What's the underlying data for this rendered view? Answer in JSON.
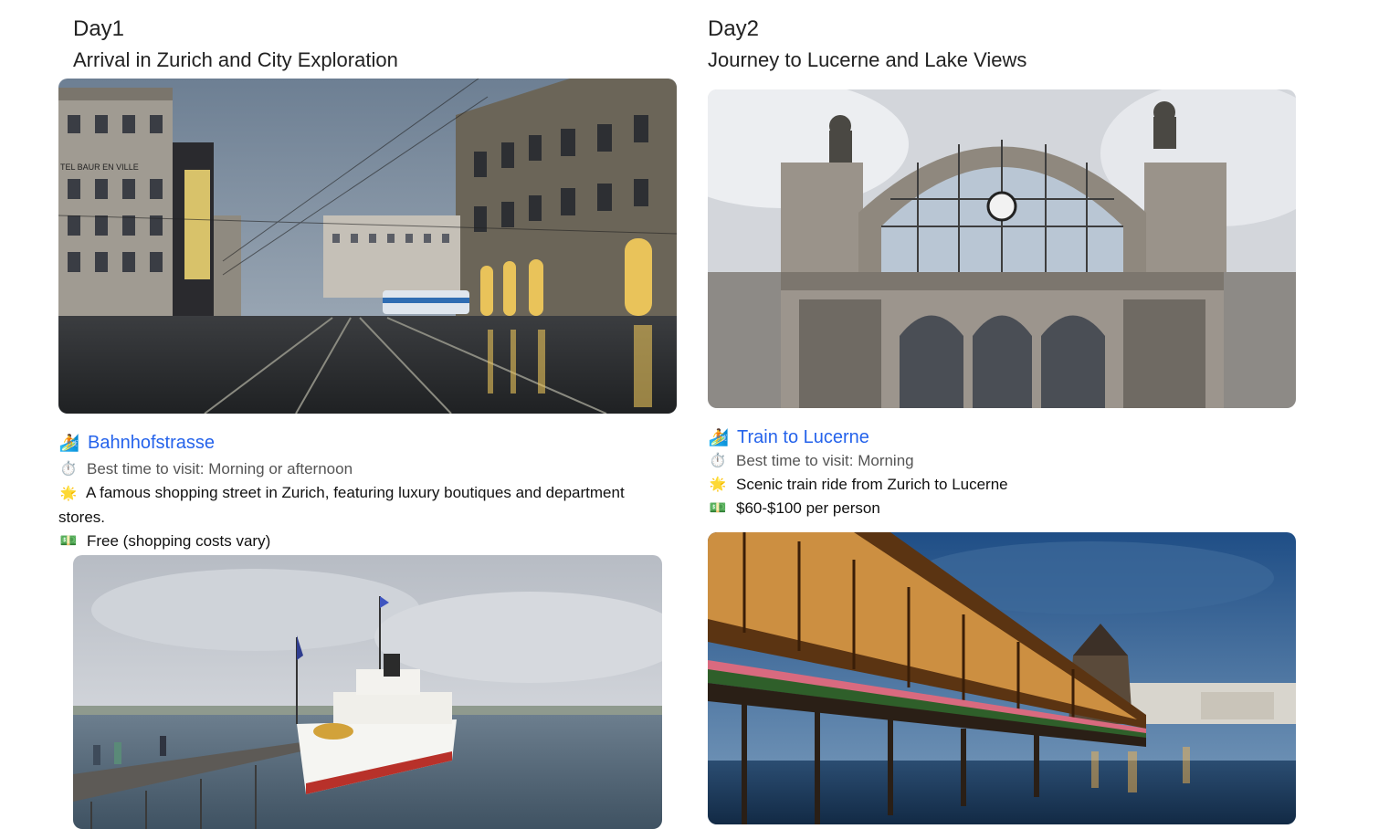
{
  "day1": {
    "label": "Day1",
    "title": "Arrival in Zurich and City Exploration",
    "item": {
      "icon": "person-walking-icon",
      "name": "Bahnhofstrasse",
      "best_time": "Best time to visit: Morning or afternoon",
      "description": "A famous shopping street in Zurich, featuring luxury boutiques and department stores.",
      "cost": "Free (shopping costs vary)"
    },
    "photo1_sign": "TEL BAUR EN VILLE"
  },
  "day2": {
    "label": "Day2",
    "title": "Journey to Lucerne and Lake Views",
    "item": {
      "icon": "person-walking-icon",
      "name": "Train to Lucerne",
      "best_time": "Best time to visit: Morning",
      "description": "Scenic train ride from Zurich to Lucerne",
      "cost": "$60-$100 per person"
    }
  },
  "icons": {
    "activity": "🏄",
    "time": "⏱️",
    "description": "🌟",
    "cost": "💵"
  },
  "colors": {
    "link_blue": "#2563eb",
    "muted_text": "#555555"
  }
}
